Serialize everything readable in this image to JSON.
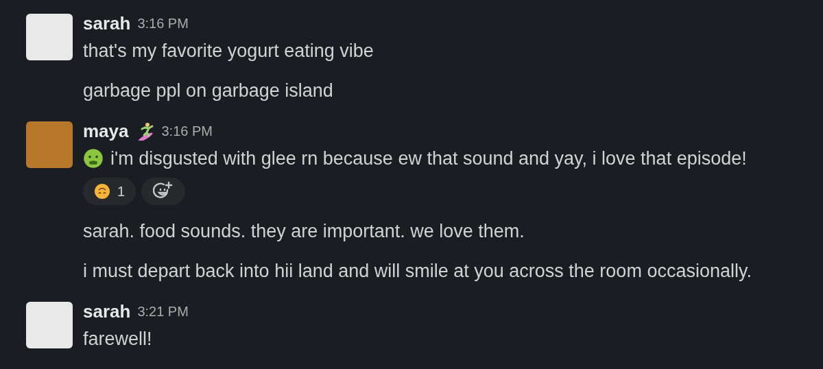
{
  "messages": [
    {
      "author": "sarah",
      "time": "3:16 PM",
      "status_icon": false,
      "posts": [
        {
          "text": "that's my favorite yogurt eating vibe",
          "lead_icon": false
        },
        {
          "text": "garbage ppl on garbage island",
          "lead_icon": false
        }
      ]
    },
    {
      "author": "maya",
      "time": "3:16 PM",
      "status_icon": true,
      "posts": [
        {
          "text": "i'm disgusted with glee rn because ew that sound and yay, i love that episode!",
          "lead_icon": true,
          "reactions": [
            {
              "count": "1"
            }
          ]
        },
        {
          "text": "sarah. food sounds. they are important. we love them.",
          "lead_icon": false
        },
        {
          "text": "i must depart back into hii land and will smile at you across the room occasionally.",
          "lead_icon": false
        }
      ]
    },
    {
      "author": "sarah",
      "time": "3:21 PM",
      "status_icon": false,
      "posts": [
        {
          "text": "farewell!",
          "lead_icon": false
        }
      ]
    }
  ]
}
